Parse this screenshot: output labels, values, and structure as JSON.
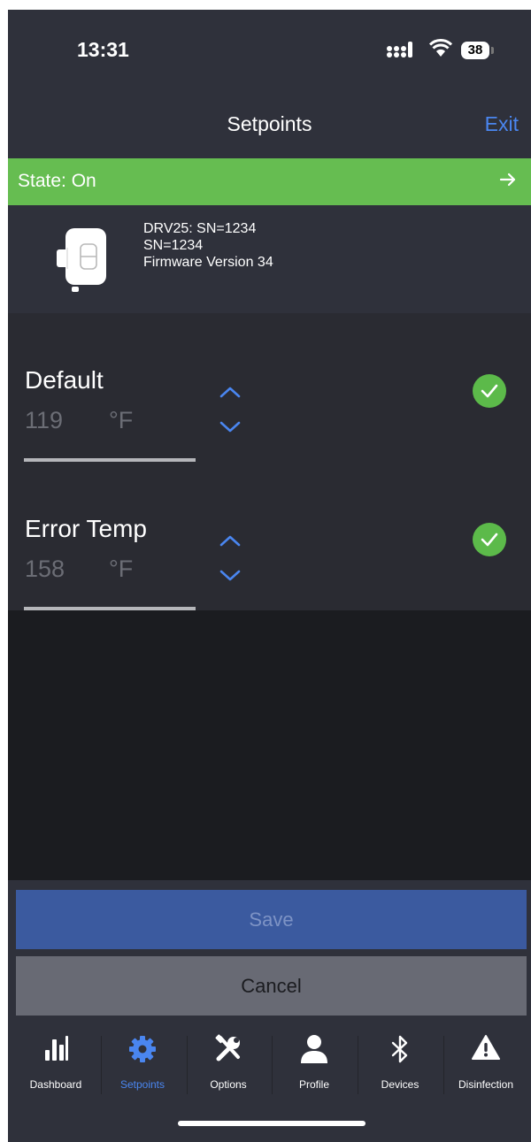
{
  "status_bar": {
    "time": "13:31",
    "battery": "38"
  },
  "header": {
    "title": "Setpoints",
    "exit_label": "Exit"
  },
  "state_bar": {
    "text": "State: On",
    "color": "#66bd51"
  },
  "device": {
    "line1": "DRV25: SN=1234",
    "line2": "SN=1234",
    "line3": "Firmware Version 34"
  },
  "setpoints": [
    {
      "label": "Default",
      "value": "119",
      "unit": "°F",
      "valid": true
    },
    {
      "label": "Error Temp",
      "value": "158",
      "unit": "°F",
      "valid": true
    }
  ],
  "actions": {
    "save_label": "Save",
    "cancel_label": "Cancel"
  },
  "tabs": [
    {
      "label": "Dashboard",
      "icon": "bar-chart-icon",
      "active": false
    },
    {
      "label": "Setpoints",
      "icon": "gear-icon",
      "active": true
    },
    {
      "label": "Options",
      "icon": "tools-icon",
      "active": false
    },
    {
      "label": "Profile",
      "icon": "person-icon",
      "active": false
    },
    {
      "label": "Devices",
      "icon": "bluetooth-icon",
      "active": false
    },
    {
      "label": "Disinfection",
      "icon": "warning-icon",
      "active": false
    }
  ],
  "colors": {
    "accent": "#4a86f0",
    "ok": "#5cba4a",
    "background": "#2f313b"
  }
}
